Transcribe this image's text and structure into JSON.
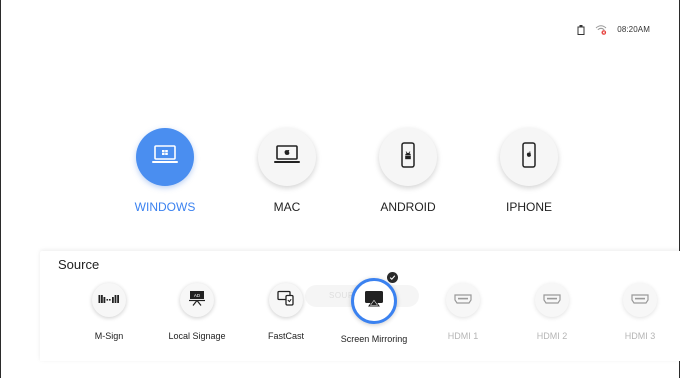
{
  "status": {
    "time": "08:20AM",
    "icons": [
      "usb-icon",
      "wifi-disconnected-icon"
    ],
    "wifi_alert_color": "#e53935"
  },
  "devices": [
    {
      "label": "WINDOWS",
      "icon": "windows-laptop-icon",
      "active": true
    },
    {
      "label": "MAC",
      "icon": "mac-laptop-icon",
      "active": false
    },
    {
      "label": "ANDROID",
      "icon": "android-phone-icon",
      "active": false
    },
    {
      "label": "IPHONE",
      "icon": "iphone-icon",
      "active": false
    }
  ],
  "source": {
    "title": "Source",
    "tooltip_text": "SOUR",
    "items": [
      {
        "label": "M-Sign",
        "icon": "m-sign-icon",
        "enabled": true
      },
      {
        "label": "Local Signage",
        "icon": "local-signage-icon",
        "enabled": true
      },
      {
        "label": "FastCast",
        "icon": "fastcast-icon",
        "enabled": true
      },
      {
        "label": "Screen Mirroring",
        "icon": "screen-mirroring-icon",
        "enabled": true,
        "selected": true
      },
      {
        "label": "HDMI 1",
        "icon": "hdmi-icon",
        "enabled": false
      },
      {
        "label": "HDMI 2",
        "icon": "hdmi-icon",
        "enabled": false
      },
      {
        "label": "HDMI 3",
        "icon": "hdmi-icon",
        "enabled": false
      }
    ]
  },
  "colors": {
    "accent": "#3b82f0",
    "active_fill": "#4a8ef0",
    "disabled_text": "#b5b5b5"
  }
}
